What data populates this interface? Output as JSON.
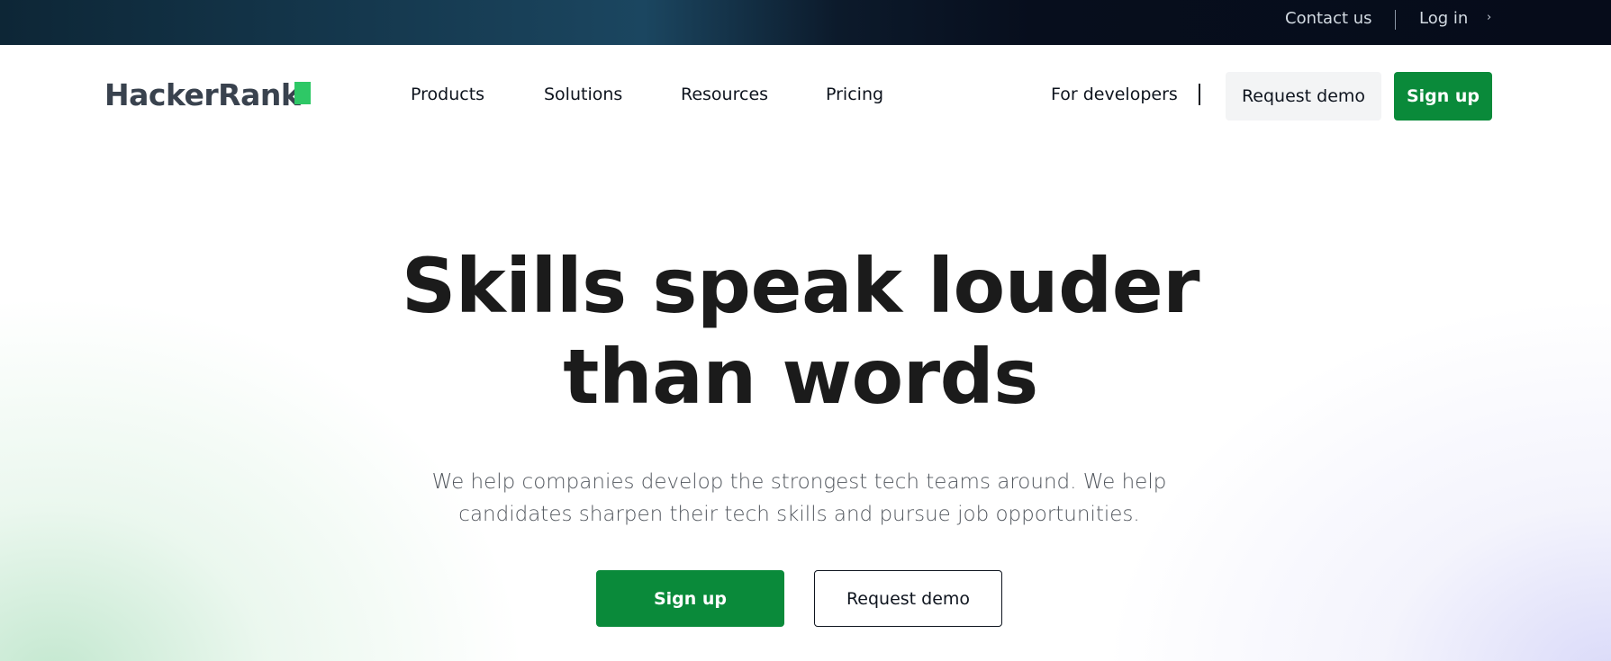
{
  "topbar": {
    "contact": "Contact us",
    "login": "Log in",
    "login_icon": "chevron-right-icon"
  },
  "nav": {
    "logo": "HackerRank",
    "items": [
      "Products",
      "Solutions",
      "Resources",
      "Pricing"
    ],
    "for_developers": "For developers",
    "request_demo": "Request demo",
    "signup": "Sign up"
  },
  "hero": {
    "headline_line1": "Skills speak louder",
    "headline_line2": "than words",
    "subtext_line1": "We help companies develop the strongest tech teams around. We help",
    "subtext_line2": "candidates sharpen their tech skills and pursue job opportunities.",
    "signup": "Sign up",
    "request_demo": "Request demo"
  },
  "colors": {
    "brand_green": "#0a8a3a",
    "logo_mark": "#2ec866",
    "topbar_dark": "#060c1a"
  }
}
